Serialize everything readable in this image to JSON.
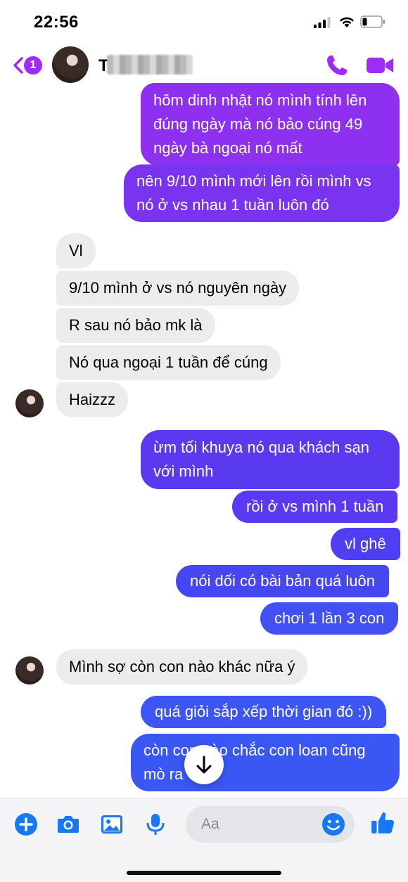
{
  "status": {
    "time": "22:56"
  },
  "header": {
    "back_badge": "1",
    "contact_name": "T",
    "accent": "#9d2cf5"
  },
  "messages": {
    "m1": "hôm dinh nhật nó mình tính lên đúng ngày mà nó bảo cúng 49 ngày bà ngoại nó mất",
    "m2": "nên 9/10 mình mới lên rồi mình vs nó ở vs nhau 1 tuần luôn đó",
    "m3": "Vl",
    "m4": "9/10 mình ở vs nó nguyên ngày",
    "m5": "R sau nó bảo mk là",
    "m6": "Nó qua ngoại 1 tuần để cúng",
    "m7": "Haizzz",
    "m8": "ừm tối khuya nó qua khách sạn với mình",
    "m9": "rồi ở vs mình 1 tuần",
    "m10": "vl ghê",
    "m11": "nói dối có bài bản quá luôn",
    "m12": "chơi 1 lần 3 con",
    "m13": "Mình sợ còn con nào khác nữa ý",
    "m14": "quá giỏi sắp xếp thời gian đó :))",
    "m15": "còn con nào chắc con loan cũng mò ra"
  },
  "bubble_colors": {
    "purple": "#8e30f0",
    "violet": "#7a34f0",
    "indigo": "#5a3af0",
    "blue": "#3a57f4"
  },
  "composer": {
    "placeholder": "Aa",
    "icons": [
      "plus-icon",
      "camera-icon",
      "image-icon",
      "mic-icon",
      "emoji-icon",
      "thumbs-up-icon"
    ],
    "icon_color": "#1877f2"
  }
}
